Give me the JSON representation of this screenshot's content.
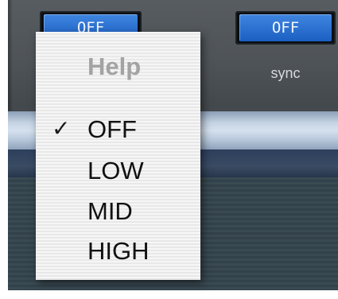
{
  "buttons": [
    {
      "label": "OFF"
    },
    {
      "label": "OFF"
    }
  ],
  "sync_label": "sync",
  "menu": {
    "items": [
      {
        "label": "Help",
        "disabled": true,
        "checked": false
      },
      {
        "label": "OFF",
        "disabled": false,
        "checked": true
      },
      {
        "label": "LOW",
        "disabled": false,
        "checked": false
      },
      {
        "label": "MID",
        "disabled": false,
        "checked": false
      },
      {
        "label": "HIGH",
        "disabled": false,
        "checked": false
      }
    ],
    "check_glyph": "✓"
  },
  "colors": {
    "button_blue": "#2a70d4",
    "panel_gray": "#4e5357",
    "menu_bg": "#f2f2f2",
    "disabled_text": "#a3a3a3"
  }
}
